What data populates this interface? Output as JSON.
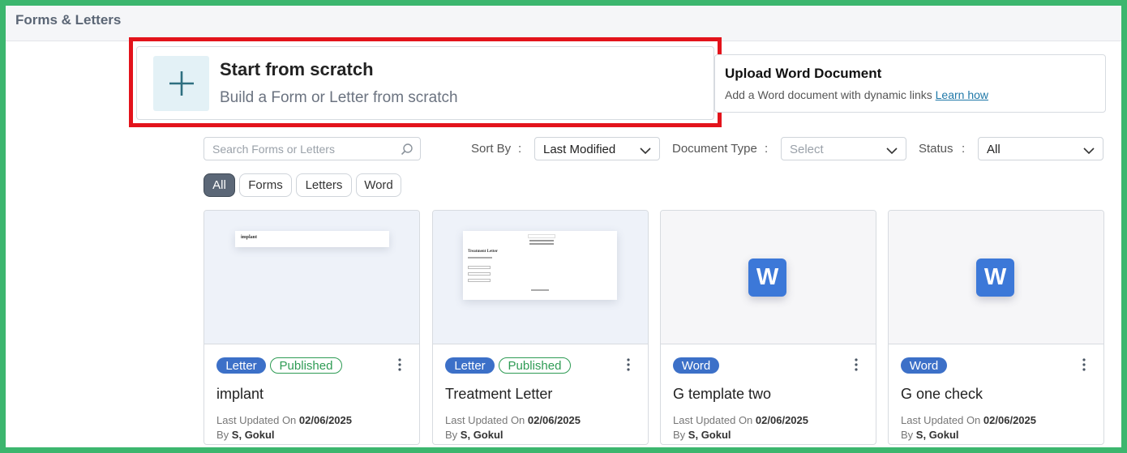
{
  "header": {
    "title": "Forms & Letters"
  },
  "scratch": {
    "title": "Start from scratch",
    "subtitle": "Build a Form or Letter from scratch"
  },
  "upload": {
    "title": "Upload Word Document",
    "subtitle": "Add a Word document with dynamic links",
    "link": "Learn how"
  },
  "search": {
    "placeholder": "Search Forms or Letters"
  },
  "filters": {
    "sort_label": "Sort By",
    "sort_value": "Last Modified",
    "doctype_label": "Document Type",
    "doctype_placeholder": "Select",
    "status_label": "Status",
    "status_value": "All",
    "separator": ":"
  },
  "tabs": [
    "All",
    "Forms",
    "Letters",
    "Word"
  ],
  "cards": [
    {
      "type": "Letter",
      "status": "Published",
      "name": "implant",
      "updated_label": "Last Updated On",
      "updated": "02/06/2025",
      "by_label": "By",
      "author": "S, Gokul",
      "thumb": "implant"
    },
    {
      "type": "Letter",
      "status": "Published",
      "name": "Treatment Letter",
      "updated_label": "Last Updated On",
      "updated": "02/06/2025",
      "by_label": "By",
      "author": "S, Gokul",
      "thumb": "Treatment Letter"
    },
    {
      "type": "Word",
      "status": "",
      "name": "G template two",
      "updated_label": "Last Updated On",
      "updated": "02/06/2025",
      "by_label": "By",
      "author": "S, Gokul",
      "thumb": "W"
    },
    {
      "type": "Word",
      "status": "",
      "name": "G one check",
      "updated_label": "Last Updated On",
      "updated": "02/06/2025",
      "by_label": "By",
      "author": "S, Gokul",
      "thumb": "W"
    }
  ],
  "colors": {
    "accent": "#3c70c8",
    "published": "#2e9b54",
    "highlight": "#e3131b",
    "frame": "#3cb66e"
  }
}
